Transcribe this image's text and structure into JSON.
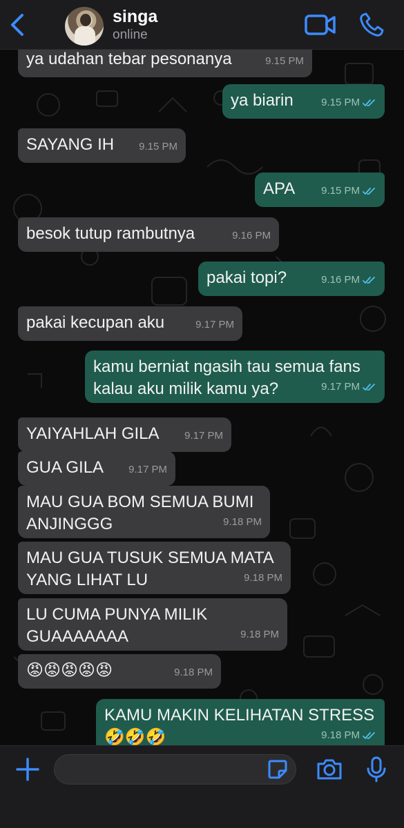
{
  "header": {
    "contact_name": "singa",
    "status": "online",
    "icons": {
      "back": "chevron-left-icon",
      "video": "video-camera-icon",
      "call": "phone-icon"
    },
    "accent_color": "#3d8bfd"
  },
  "messages": [
    {
      "dir": "in",
      "text": "ya udahan tebar pesonanya",
      "time": "9.15 PM"
    },
    {
      "dir": "out",
      "text": "ya biarin",
      "time": "9.15 PM",
      "read": true
    },
    {
      "dir": "in",
      "text": "SAYANG IH",
      "time": "9.15 PM"
    },
    {
      "dir": "out",
      "text": "APA",
      "time": "9.15 PM",
      "read": true
    },
    {
      "dir": "in",
      "text": "besok tutup rambutnya",
      "time": "9.16 PM"
    },
    {
      "dir": "out",
      "text": "pakai topi?",
      "time": "9.16 PM",
      "read": true
    },
    {
      "dir": "in",
      "text": "pakai kecupan aku",
      "time": "9.17 PM"
    },
    {
      "dir": "out",
      "text": "kamu berniat ngasih tau semua fans\nkalau aku milik kamu ya?",
      "time": "9.17 PM",
      "read": true
    },
    {
      "dir": "in",
      "text": "YAIYAHLAH GILA",
      "time": "9.17 PM"
    },
    {
      "dir": "in",
      "text": "GUA GILA",
      "time": "9.17 PM"
    },
    {
      "dir": "in",
      "text": "MAU GUA BOM SEMUA BUMI\nANJINGGG",
      "time": "9.18 PM"
    },
    {
      "dir": "in",
      "text": "MAU GUA TUSUK SEMUA MATA\nYANG LIHAT LU",
      "time": "9.18 PM"
    },
    {
      "dir": "in",
      "text": "LU CUMA PUNYA MILIK\nGUAAAAAAA",
      "time": "9.18 PM"
    },
    {
      "dir": "in",
      "text": "😡😡😡😡😡",
      "time": "9.18 PM"
    },
    {
      "dir": "out",
      "text": "KAMU MAKIN KELIHATAN STRESS\n🤣🤣🤣",
      "time": "9.18 PM",
      "read": true
    }
  ],
  "input": {
    "placeholder": "",
    "value": "",
    "icons": {
      "attach": "plus-icon",
      "sticker": "sticker-icon",
      "camera": "camera-icon",
      "mic": "microphone-icon"
    }
  },
  "colors": {
    "incoming_bubble": "#3b3b3d",
    "outgoing_bubble": "#1f5c4d",
    "read_tick": "#53bdeb",
    "background": "#0b0b0b"
  }
}
